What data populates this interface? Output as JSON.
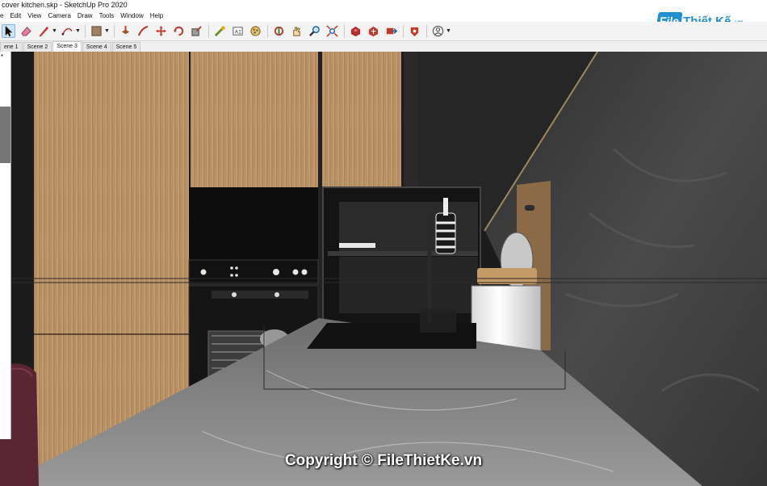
{
  "window": {
    "title": "cover kitchen.skp - SketchUp Pro 2020"
  },
  "menu": {
    "items": [
      "e",
      "Edit",
      "View",
      "Camera",
      "Draw",
      "Tools",
      "Window",
      "Help"
    ]
  },
  "toolbar": {
    "tools": [
      {
        "icon": "select-arrow-icon",
        "selected": true
      },
      {
        "icon": "eraser-icon"
      },
      {
        "icon": "pencil-line-icon",
        "dropdown": true
      },
      {
        "icon": "arc-icon",
        "dropdown": true
      },
      {
        "icon": "rectangle-shape-icon",
        "dropdown": true
      },
      {
        "icon": "push-pull-icon"
      },
      {
        "icon": "follow-me-icon"
      },
      {
        "icon": "move-icon"
      },
      {
        "icon": "rotate-icon"
      },
      {
        "icon": "scale-icon"
      },
      {
        "icon": "tape-measure-icon"
      },
      {
        "icon": "text-icon"
      },
      {
        "icon": "paint-bucket-icon"
      },
      {
        "icon": "orbit-icon"
      },
      {
        "icon": "pan-icon"
      },
      {
        "icon": "zoom-icon"
      },
      {
        "icon": "zoom-extents-icon"
      },
      {
        "icon": "3d-warehouse-icon"
      },
      {
        "icon": "extension-warehouse-icon"
      },
      {
        "icon": "send-to-layout-icon"
      },
      {
        "icon": "extension-manager-icon"
      },
      {
        "icon": "account-icon",
        "dropdown": true
      }
    ]
  },
  "scenes": {
    "tabs": [
      "ene 1",
      "Scene 2",
      "Scene 3",
      "Scene 4",
      "Scene 5"
    ],
    "active_index": 2
  },
  "left_panel": {
    "tag": "*"
  },
  "brand": {
    "box": "File",
    "name": "Thiết Kế",
    "tld": ".vn"
  },
  "watermark": {
    "text": "Copyright © FileThietKe.vn"
  },
  "colors": {
    "wood": "#b58f63",
    "wall": "#3b3b3b",
    "counter": "#7f7f7f",
    "brand_blue": "#1f8fd1",
    "chair": "#5a2633"
  }
}
